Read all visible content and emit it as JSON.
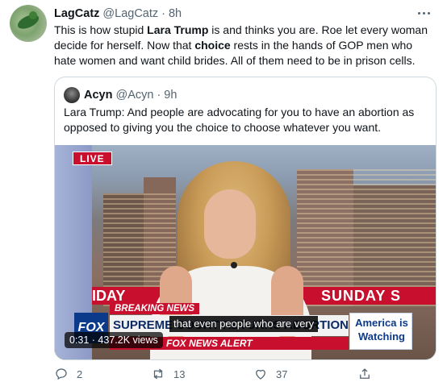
{
  "tweet": {
    "display_name": "LagCatz",
    "handle": "@LagCatz",
    "separator": "·",
    "time": "8h",
    "text_parts": [
      "This is how stupid ",
      "Lara Trump",
      " is and thinks you are. Roe let every woman decide for herself. Now that ",
      "choice",
      " rests in the hands of GOP men who hate women and want child brides. All of them need to be in prison cells."
    ]
  },
  "quoted": {
    "display_name": "Acyn",
    "handle": "@Acyn",
    "separator": "·",
    "time": "9h",
    "text": "Lara Trump: And people are advocating for you to have an abortion as opposed to giving you the choice to choose whatever you want.",
    "video": {
      "live_label": "LIVE",
      "banner_left": "IDAY",
      "banner_right": "SUNDAY S",
      "network_logo": "FOX",
      "breaking_label": "BREAKING NEWS",
      "headline": "SUPREME COURT RETURNS ABORTION TO STATES",
      "alert_label": "FOX NEWS ALERT",
      "show_title": "America is Watching",
      "caption": "that even people who are very",
      "views_text": "0:31 · 437.2K views"
    }
  },
  "actions": {
    "reply_count": "2",
    "retweet_count": "13",
    "like_count": "37"
  },
  "icons": [
    "more-icon",
    "reply-icon",
    "retweet-icon",
    "like-icon",
    "share-icon"
  ],
  "colors": {
    "text": "#0f1419",
    "muted": "#536471",
    "border": "#cfd9de",
    "fox_red": "#c8102e",
    "fox_blue": "#0c3a8a"
  }
}
